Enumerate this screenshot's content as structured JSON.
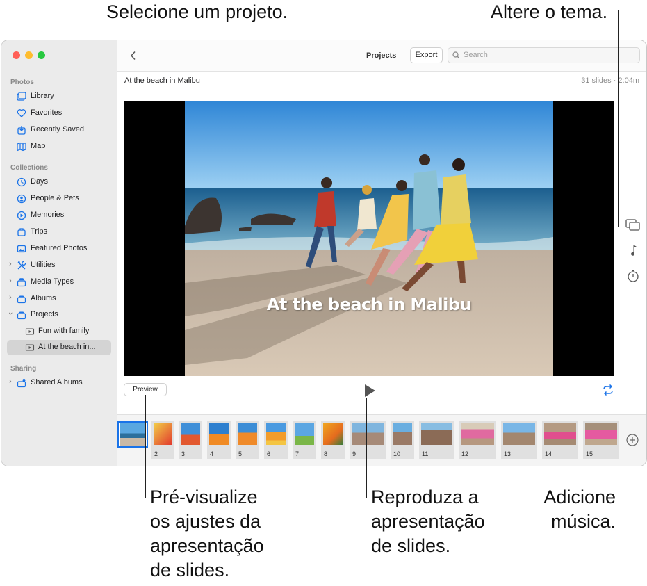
{
  "callouts": {
    "select_project": "Selecione um projeto.",
    "change_theme": "Altere o tema.",
    "preview_line1": "Pré-visualize",
    "preview_line2": "os ajustes da",
    "preview_line3": "apresentação",
    "preview_line4": "de slides.",
    "play_line1": "Reproduza a",
    "play_line2": "apresentação",
    "play_line3": "de slides.",
    "music_line1": "Adicione",
    "music_line2": "música."
  },
  "sidebar": {
    "photos_header": "Photos",
    "photos_items": [
      "Library",
      "Favorites",
      "Recently Saved",
      "Map"
    ],
    "collections_header": "Collections",
    "collections_items": [
      "Days",
      "People & Pets",
      "Memories",
      "Trips",
      "Featured Photos",
      "Utilities",
      "Media Types",
      "Albums",
      "Projects",
      "Fun with family",
      "At the beach in..."
    ],
    "sharing_header": "Sharing",
    "sharing_items": [
      "Shared Albums"
    ],
    "selected": "At the beach in..."
  },
  "toolbar": {
    "title": "Projects",
    "export_label": "Export",
    "search_placeholder": "Search"
  },
  "project": {
    "name": "At the beach in Malibu",
    "meta": "31 slides · 2:04m",
    "overlay_title": "At the beach in Malibu"
  },
  "controls": {
    "preview_label": "Preview"
  },
  "thumbnails": [
    "",
    "2",
    "3",
    "4",
    "5",
    "6",
    "7",
    "8",
    "9",
    "10",
    "11",
    "12",
    "13",
    "14",
    "15"
  ],
  "icons": {
    "back": "chevron-left-icon",
    "search": "search-icon",
    "theme": "theme-icon",
    "music": "music-note-icon",
    "duration": "timer-icon",
    "play": "play-icon",
    "loop": "loop-icon",
    "add": "plus-circle-icon"
  },
  "colors": {
    "accent": "#1a73e8",
    "sidebar_bg": "#ebebeb",
    "selection": "#d4d4d4"
  }
}
